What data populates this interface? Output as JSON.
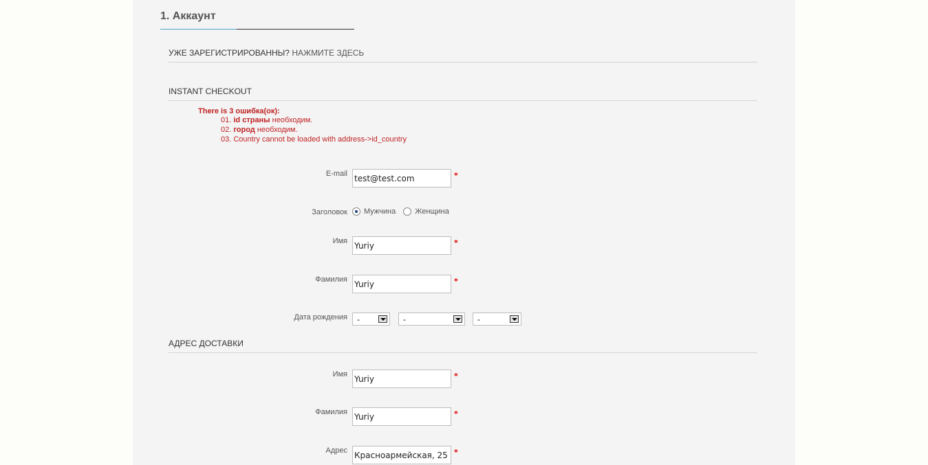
{
  "page": {
    "title": "1. Аккаунт"
  },
  "login": {
    "prefix": "УЖЕ ЗАРЕГИСТРИРОВАННЫ?",
    "link": "НАЖМИТЕ ЗДЕСЬ"
  },
  "instant": {
    "title": "INSTANT CHECKOUT"
  },
  "errors": {
    "header": "There is 3 ошибка(ок):",
    "items": [
      {
        "num": "01.",
        "bold": "id страны",
        "rest": " необходим."
      },
      {
        "num": "02.",
        "bold": "город",
        "rest": " необходим."
      },
      {
        "num": "03.",
        "bold": "",
        "rest": "Country cannot be loaded with address->id_country"
      }
    ]
  },
  "account": {
    "email_label": "E-mail",
    "email_value": "test@test.com",
    "title_label": "Заголовок",
    "gender_options": [
      {
        "label": "Мужчина",
        "selected": true
      },
      {
        "label": "Женщина",
        "selected": false
      }
    ],
    "firstname_label": "Имя",
    "firstname_value": "Yuriy",
    "lastname_label": "Фамилия",
    "lastname_value": "Yuriy",
    "birthday_label": "Дата рождения",
    "birthday_day": "-",
    "birthday_month": "-",
    "birthday_year": "-",
    "required_mark": "*"
  },
  "delivery": {
    "title": "АДРЕС ДОСТАВКИ",
    "firstname_label": "Имя",
    "firstname_value": "Yuriy",
    "lastname_label": "Фамилия",
    "lastname_value": "Yuriy",
    "address_label": "Адрес",
    "address_value": "Красноармейская, 25"
  },
  "colors": {
    "accent": "#4aa3c4",
    "error": "#c02020",
    "required": "#dd0000",
    "panel_bg": "#f4f4f5"
  }
}
